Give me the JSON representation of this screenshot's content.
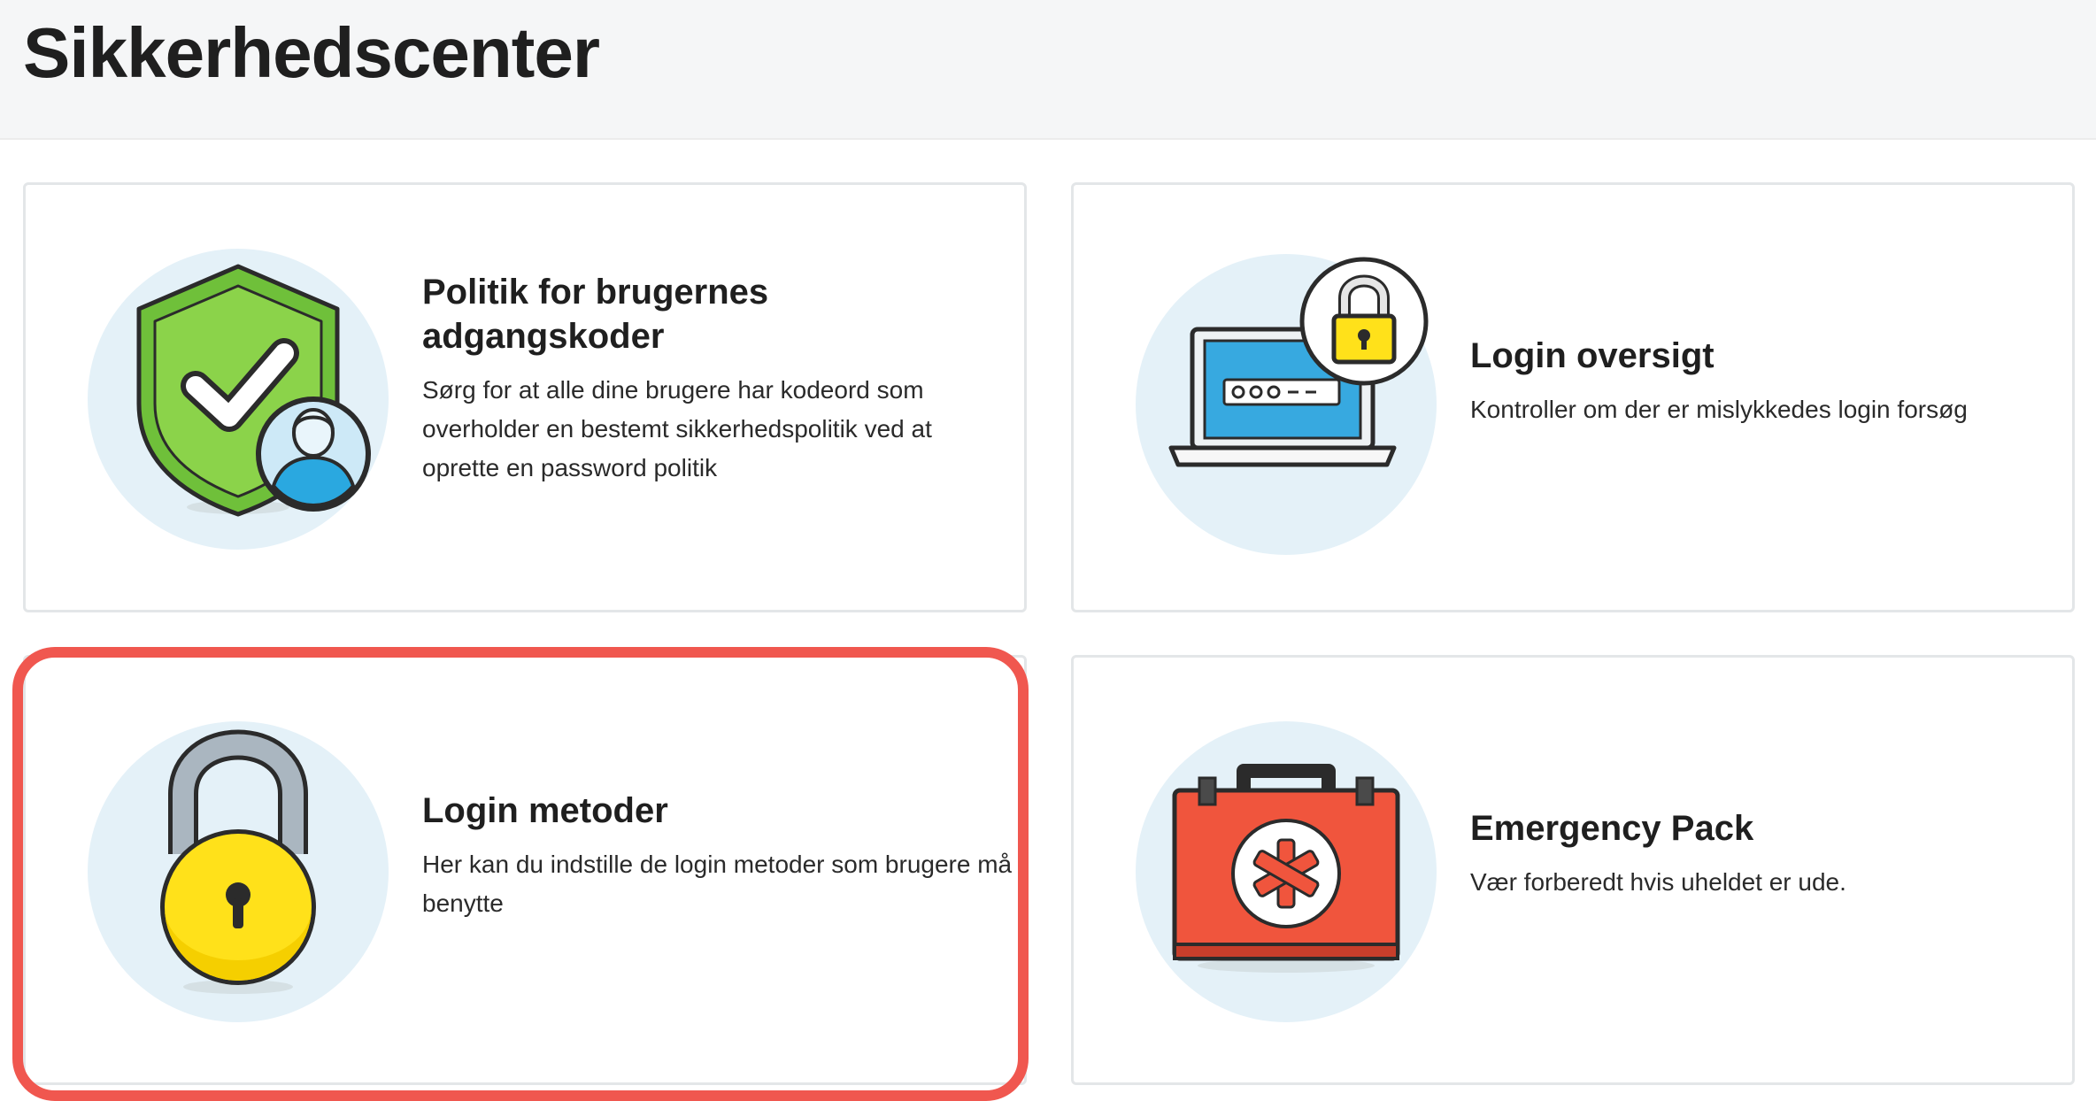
{
  "header": {
    "title": "Sikkerhedscenter"
  },
  "cards": [
    {
      "id": "password-policy",
      "title": "Politik for brugernes adgangskoder",
      "description": "Sørg for at alle dine brugere har kodeord som overholder en bestemt sikkerhedspolitik ved at oprette en password politik",
      "icon": "shield-user-icon"
    },
    {
      "id": "login-overview",
      "title": "Login oversigt",
      "description": "Kontroller om der er mislykkedes login forsøg",
      "icon": "laptop-lock-icon"
    },
    {
      "id": "login-methods",
      "title": "Login metoder",
      "description": "Her kan du indstille de login metoder som brugere må benytte",
      "icon": "padlock-icon",
      "highlighted": true
    },
    {
      "id": "emergency-pack",
      "title": "Emergency Pack",
      "description": "Vær forberedt hvis uheldet er ude.",
      "icon": "first-aid-kit-icon"
    }
  ],
  "colors": {
    "highlight": "#f0574f",
    "icon_circle": "#e4f1f8",
    "shield_green": "#8bd34a",
    "lock_yellow": "#ffe11a",
    "kit_red": "#f0553d",
    "screen_blue": "#37a9e0"
  }
}
